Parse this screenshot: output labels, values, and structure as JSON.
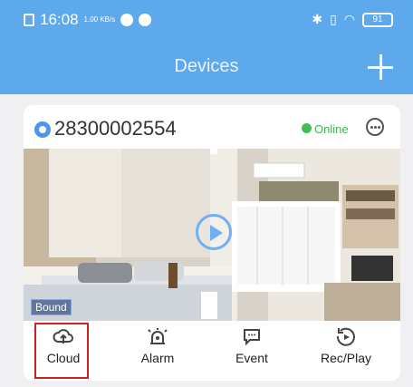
{
  "status_bar": {
    "time": "16:08",
    "speed": "1.00\nKB/s",
    "battery": "91"
  },
  "header": {
    "title": "Devices"
  },
  "device": {
    "id": "28300002554",
    "status": "Online",
    "badge": "Bound"
  },
  "actions": [
    {
      "label": "Cloud",
      "icon": "cloud-upload-icon"
    },
    {
      "label": "Alarm",
      "icon": "alarm-icon"
    },
    {
      "label": "Event",
      "icon": "event-icon"
    },
    {
      "label": "Rec/Play",
      "icon": "playback-icon"
    }
  ],
  "colors": {
    "header": "#5ea9ec",
    "online": "#39b54a",
    "highlight": "#cc2222",
    "accent": "#6fb0f2"
  }
}
